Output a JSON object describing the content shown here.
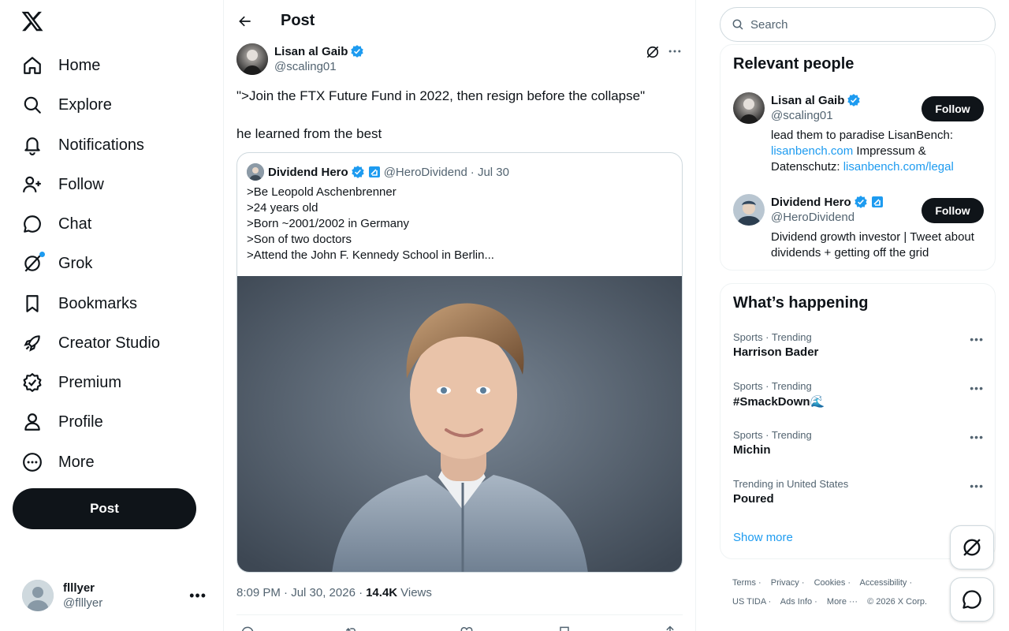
{
  "nav": {
    "items": [
      {
        "label": "Home",
        "icon": "home-icon"
      },
      {
        "label": "Explore",
        "icon": "search-icon"
      },
      {
        "label": "Notifications",
        "icon": "bell-icon"
      },
      {
        "label": "Follow",
        "icon": "person-plus-icon"
      },
      {
        "label": "Chat",
        "icon": "chat-bubble-icon"
      },
      {
        "label": "Grok",
        "icon": "grok-icon"
      },
      {
        "label": "Bookmarks",
        "icon": "bookmark-icon"
      },
      {
        "label": "Creator Studio",
        "icon": "rocket-icon"
      },
      {
        "label": "Premium",
        "icon": "verified-badge-icon"
      },
      {
        "label": "Profile",
        "icon": "person-icon"
      },
      {
        "label": "More",
        "icon": "more-circle-icon"
      }
    ],
    "post_label": "Post",
    "account": {
      "name": "flllyer",
      "handle": "@flllyer"
    }
  },
  "main": {
    "title": "Post",
    "post": {
      "author_name": "Lisan al Gaib",
      "author_handle": "@scaling01",
      "text_line1": "\">Join the FTX Future Fund in 2022, then resign before the collapse\"",
      "text_line2": "he learned from the best",
      "quote": {
        "name": "Dividend Hero",
        "handle": "@HeroDividend",
        "date": "· Jul 30",
        "lines": [
          ">Be Leopold Aschenbrenner",
          ">24 years old",
          ">Born ~2001/2002 in Germany",
          ">Son of two doctors",
          ">Attend the John F. Kennedy School in Berlin..."
        ]
      },
      "time": "8:09 PM · Jul 30, 2026 ·",
      "views_count": "14.4K",
      "views_label": "Views"
    }
  },
  "right": {
    "search_placeholder": "Search",
    "relevant_title": "Relevant people",
    "people": [
      {
        "name": "Lisan al Gaib",
        "handle": "@scaling01",
        "bio_pre": "lead them to paradise LisanBench: ",
        "bio_link1": "lisanbench.com",
        "bio_mid": " Impressum & Datenschutz: ",
        "bio_link2": "lisanbench.com/legal",
        "follow": "Follow"
      },
      {
        "name": "Dividend Hero",
        "handle": "@HeroDividend",
        "bio": "Dividend growth investor | Tweet about dividends + getting off the grid",
        "follow": "Follow"
      }
    ],
    "happening_title": "What’s happening",
    "trends": [
      {
        "category": "Sports · Trending",
        "title": "Harrison Bader"
      },
      {
        "category": "Sports · Trending",
        "title": "#SmackDown🌊"
      },
      {
        "category": "Sports · Trending",
        "title": "Michin"
      },
      {
        "category": "Trending in United States",
        "title": "Poured"
      }
    ],
    "show_more": "Show more",
    "footer": [
      "Terms ·",
      "Privacy ·",
      "Cookies ·",
      "Accessibility ·",
      "US TIDA ·",
      "Ads Info ·",
      "More ···",
      "© 2026 X Corp."
    ]
  }
}
